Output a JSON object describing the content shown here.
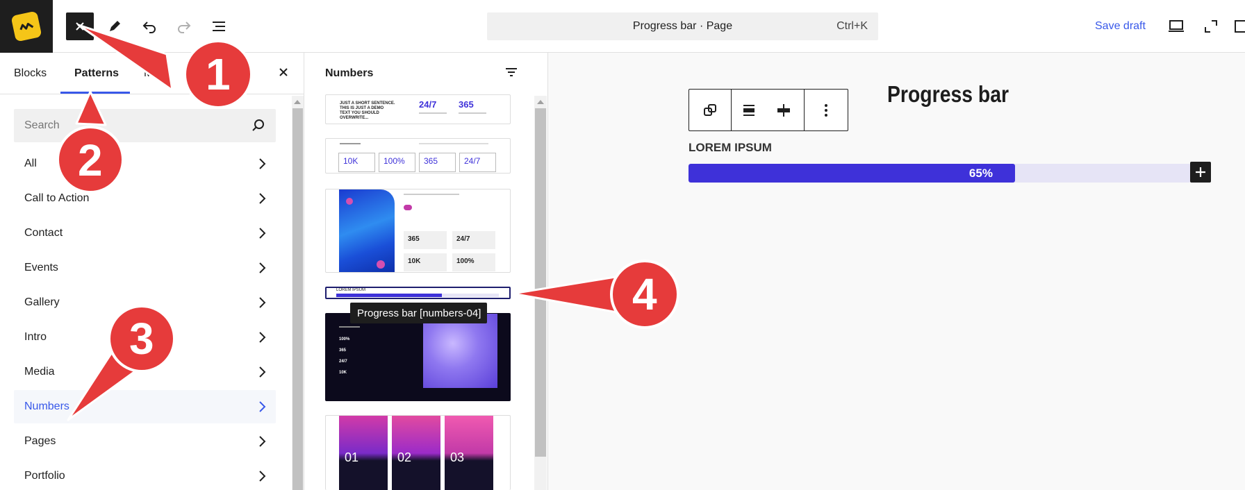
{
  "topbar": {
    "close_icon": "close-icon",
    "tools": [
      "edit-pencil-icon",
      "undo-icon",
      "redo-icon",
      "document-overview-icon"
    ],
    "command_title": "Progress bar · Page",
    "command_shortcut": "Ctrl+K",
    "save_draft": "Save draft",
    "right_icons": [
      "desktop-preview-icon",
      "fullscreen-icon"
    ]
  },
  "sidebar": {
    "tabs": [
      {
        "label": "Blocks",
        "active": false
      },
      {
        "label": "Patterns",
        "active": true
      },
      {
        "label": "Me",
        "active": false
      }
    ],
    "search_placeholder": "Search",
    "categories": [
      {
        "label": "All",
        "active": false
      },
      {
        "label": "Call to Action",
        "active": false
      },
      {
        "label": "Contact",
        "active": false
      },
      {
        "label": "Events",
        "active": false
      },
      {
        "label": "Gallery",
        "active": false
      },
      {
        "label": "Intro",
        "active": false
      },
      {
        "label": "Media",
        "active": false
      },
      {
        "label": "Numbers",
        "active": true
      },
      {
        "label": "Pages",
        "active": false
      },
      {
        "label": "Portfolio",
        "active": false
      }
    ]
  },
  "patterns": {
    "title": "Numbers",
    "p1": {
      "lead": "JUST A SHORT SENTENCE. THIS IS JUST A DEMO TEXT YOU SHOULD OVERWRITE...",
      "stat1": "24/7",
      "stat2": "365"
    },
    "p2": {
      "stats": [
        "10K",
        "100%",
        "365",
        "24/7"
      ]
    },
    "p3": {
      "stats": [
        "365",
        "24/7",
        "10K",
        "100%"
      ]
    },
    "p4": {
      "label": "LOREM IPSUM",
      "value": "65%"
    },
    "p5": {
      "stats": [
        "100%",
        "365",
        "24/7",
        "10K"
      ]
    },
    "p6": {
      "nums": [
        "01",
        "02",
        "03"
      ]
    },
    "tooltip": "Progress bar [numbers-04]"
  },
  "editor": {
    "block_toolbar_icons": [
      "block-type-icon",
      "align-icon",
      "justify-icon",
      "more-options-icon"
    ],
    "heading": "Progress bar",
    "label": "LOREM IPSUM",
    "progress_text": "65%",
    "progress_value": 0.65,
    "accent": "#3e31d9",
    "track": "#e6e4f6"
  },
  "annotations": [
    "1",
    "2",
    "3",
    "4"
  ],
  "colors": {
    "brand": "#3858e9",
    "annotation": "#e63b3b",
    "logo": "#f5c518"
  }
}
